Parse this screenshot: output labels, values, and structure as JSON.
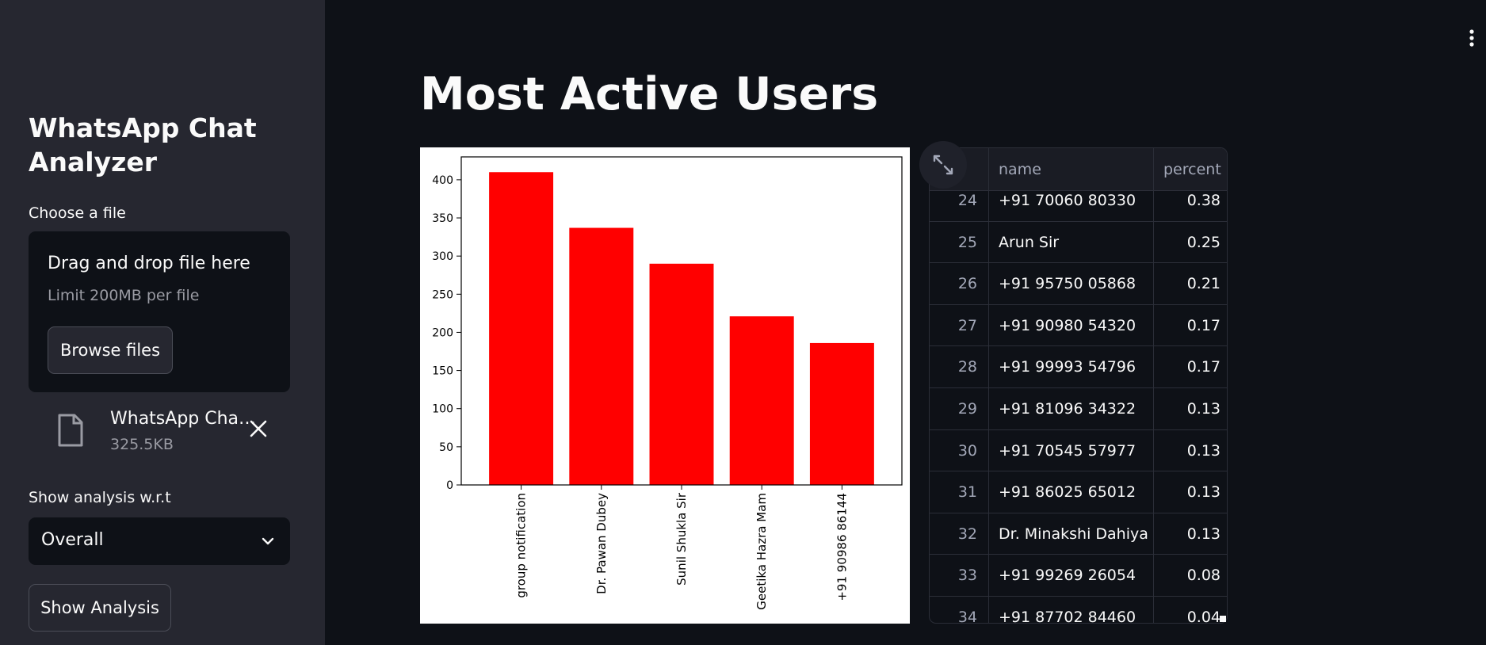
{
  "sidebar": {
    "title": "WhatsApp Chat Analyzer",
    "file_label": "Choose a file",
    "dropzone": {
      "title": "Drag and drop file here",
      "limit": "Limit 200MB per file",
      "browse_label": "Browse files"
    },
    "uploaded_file": {
      "name": "WhatsApp Cha…",
      "size": "325.5KB",
      "icon": "file-icon"
    },
    "analysis_label": "Show analysis w.r.t",
    "select_value": "Overall",
    "show_button": "Show Analysis"
  },
  "main": {
    "title": "Most Active Users"
  },
  "chart_data": {
    "type": "bar",
    "categories": [
      "group notification",
      "Dr. Pawan Dubey",
      "Sunil Shukla Sir",
      "Geetika Hazra Mam",
      "+91 90986 86144"
    ],
    "values": [
      410,
      337,
      290,
      221,
      186
    ],
    "ylim": [
      0,
      430
    ],
    "yticks": [
      0,
      50,
      100,
      150,
      200,
      250,
      300,
      350,
      400
    ],
    "color": "#ff0000",
    "title": "",
    "xlabel": "",
    "ylabel": ""
  },
  "table": {
    "columns": [
      "",
      "name",
      "percent"
    ],
    "rows": [
      {
        "idx": "24",
        "name": "+91 70060 80330",
        "percent": "0.38"
      },
      {
        "idx": "25",
        "name": "Arun Sir",
        "percent": "0.25"
      },
      {
        "idx": "26",
        "name": "+91 95750 05868",
        "percent": "0.21"
      },
      {
        "idx": "27",
        "name": "+91 90980 54320",
        "percent": "0.17"
      },
      {
        "idx": "28",
        "name": "+91 99993 54796",
        "percent": "0.17"
      },
      {
        "idx": "29",
        "name": "+91 81096 34322",
        "percent": "0.13"
      },
      {
        "idx": "30",
        "name": "+91 70545 57977",
        "percent": "0.13"
      },
      {
        "idx": "31",
        "name": "+91 86025 65012",
        "percent": "0.13"
      },
      {
        "idx": "32",
        "name": "Dr. Minakshi Dahiya Mam",
        "percent": "0.13"
      },
      {
        "idx": "33",
        "name": "+91 99269 26054",
        "percent": "0.08"
      },
      {
        "idx": "34",
        "name": "+91 87702 84460",
        "percent": "0.04"
      }
    ]
  }
}
